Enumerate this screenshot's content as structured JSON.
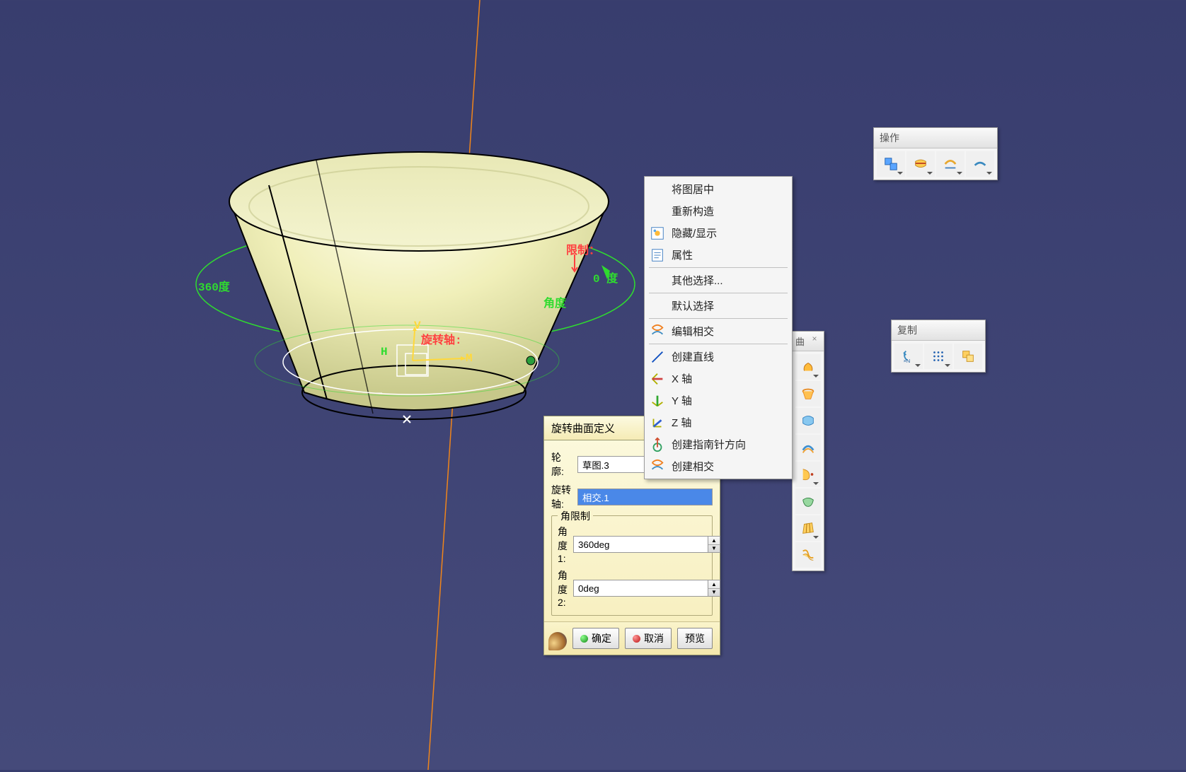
{
  "viewport": {
    "annotations": {
      "angle360": "360度",
      "angle0": "0 度",
      "angleLabel": "角度",
      "limitRed": "限制：",
      "axisLabel": "旋转轴:",
      "h": "H",
      "v": "V",
      "m": "M"
    }
  },
  "dialog": {
    "title": "旋转曲面定义",
    "profileLabel": "轮廓:",
    "profileValue": "草图.3",
    "axisLabel": "旋转轴:",
    "axisValue": "相交.1",
    "limitGroup": "角限制",
    "angle1Label": "角度 1:",
    "angle1Value": "360deg",
    "angle2Label": "角度 2:",
    "angle2Value": "0deg",
    "ok": "确定",
    "cancel": "取消",
    "preview": "预览"
  },
  "contextMenu": {
    "items": [
      {
        "label": "将图居中",
        "icon": null
      },
      {
        "label": "重新构造",
        "icon": null
      },
      {
        "label": "隐藏/显示",
        "icon": "hide-show"
      },
      {
        "label": "属性",
        "icon": "props"
      }
    ],
    "items2": [
      {
        "label": "其他选择...",
        "icon": null
      }
    ],
    "items3": [
      {
        "label": "默认选择",
        "icon": null
      }
    ],
    "items4": [
      {
        "label": "编辑相交",
        "icon": "intersect"
      }
    ],
    "items5": [
      {
        "label": "创建直线",
        "icon": "line"
      },
      {
        "label": "X 轴",
        "icon": "x-axis"
      },
      {
        "label": "Y 轴",
        "icon": "y-axis"
      },
      {
        "label": "Z 轴",
        "icon": "z-axis"
      },
      {
        "label": "创建指南针方向",
        "icon": "compass"
      },
      {
        "label": "创建相交",
        "icon": "intersect"
      }
    ]
  },
  "toolbars": {
    "ops": {
      "title": "操作"
    },
    "copy": {
      "title": "复制"
    },
    "vertical": {
      "title": "曲"
    }
  }
}
